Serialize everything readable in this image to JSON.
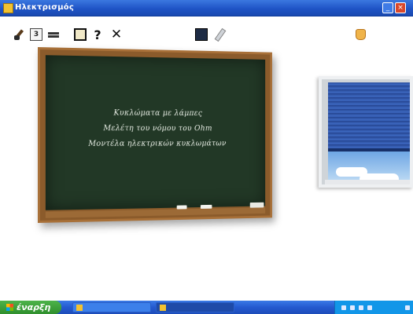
{
  "window": {
    "title": "Ηλεκτρισμός",
    "controls": {
      "minimize_icon": "minimize-icon",
      "close_icon": "close-icon"
    }
  },
  "toolbar": {
    "icons": [
      "brush-icon",
      "document-icon",
      "text-icon",
      "book-icon",
      "help-icon",
      "exit-icon",
      "blackboard-icon",
      "chalk-icon",
      "hand-icon"
    ],
    "help_glyph": "?",
    "exit_glyph": "✕",
    "doc_glyph": "3"
  },
  "blackboard": {
    "lines": [
      "Κυκλώματα με λάμπες",
      "Μελέτη του νόμου του Ohm",
      "Μοντέλα ηλεκτρικών κυκλωμάτων"
    ]
  },
  "taskbar": {
    "start_label": "έναρξη",
    "tasks": [
      "",
      ""
    ],
    "clock": ""
  },
  "colors": {
    "titlebar": "#2058c8",
    "board": "#223826",
    "frame": "#8b5b2b",
    "taskbar": "#2459cf",
    "start": "#3a9a37"
  }
}
